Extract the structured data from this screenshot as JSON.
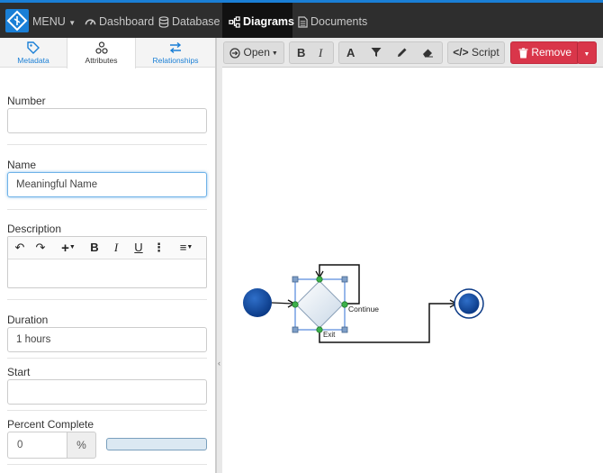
{
  "topnav": {
    "menu_label": "MENU",
    "items": [
      {
        "label": "Dashboard",
        "icon": "dashboard-icon"
      },
      {
        "label": "Database",
        "icon": "database-icon"
      },
      {
        "label": "Diagrams",
        "icon": "diagram-icon",
        "active": true
      },
      {
        "label": "Documents",
        "icon": "document-icon"
      }
    ]
  },
  "tabs": [
    {
      "label": "Metadata",
      "icon": "tag-icon"
    },
    {
      "label": "Attributes",
      "icon": "attributes-icon",
      "active": true
    },
    {
      "label": "Relationships",
      "icon": "arrows-exchange-icon"
    }
  ],
  "form": {
    "number": {
      "label": "Number",
      "value": ""
    },
    "name": {
      "label": "Name",
      "value": "Meaningful Name"
    },
    "description": {
      "label": "Description",
      "value": ""
    },
    "duration": {
      "label": "Duration",
      "value": "1 hours"
    },
    "start": {
      "label": "Start",
      "value": ""
    },
    "percent": {
      "label": "Percent Complete",
      "value": "0",
      "unit": "%",
      "progress": 0
    }
  },
  "toolbar": {
    "open_label": "Open",
    "script_label": "Script",
    "remove_label": "Remove"
  },
  "diagram": {
    "labels": {
      "continue": "Continue",
      "exit": "Exit"
    }
  },
  "colors": {
    "accent": "#1a7fd6",
    "danger": "#d9364a",
    "topbar": "#2e2e2e"
  }
}
